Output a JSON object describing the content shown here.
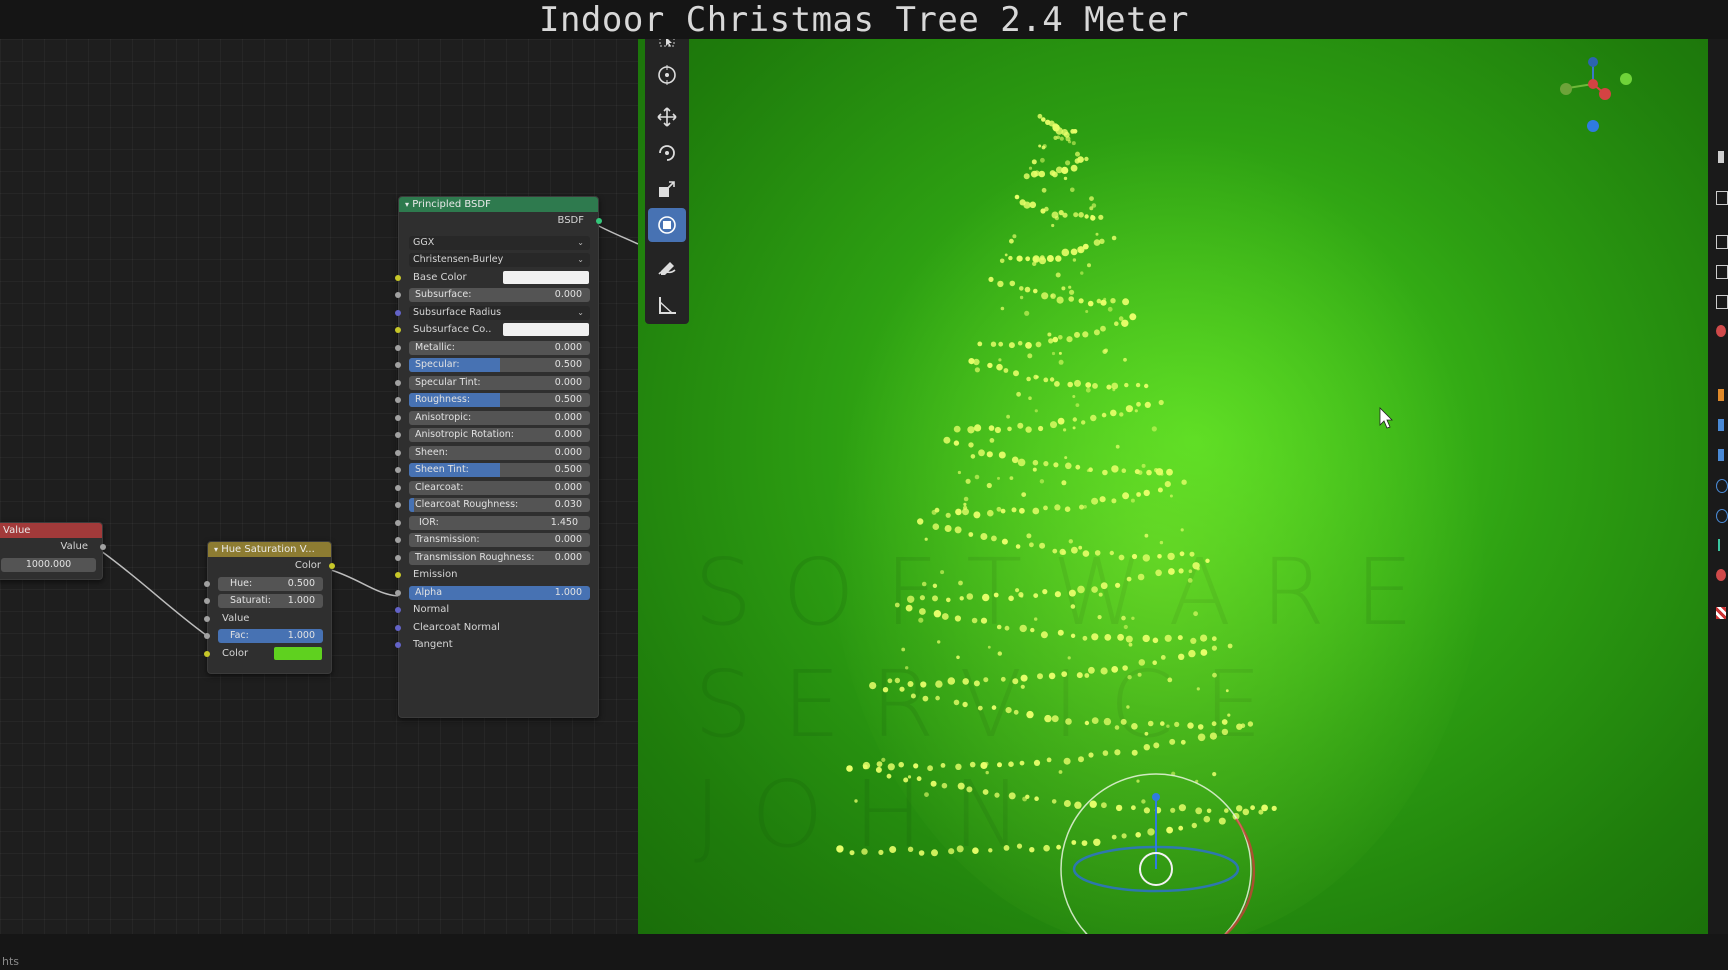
{
  "title": "Indoor Christmas Tree 2.4 Meter",
  "status_text": "hts",
  "colors": {
    "viewport_green": "#3fbf18",
    "active_blue": "#4772b3",
    "value_header": "#a23a3a",
    "hue_header": "#8d7c32",
    "bsdf_header": "#2e7a4e",
    "light_yellow": "#e8ff6a"
  },
  "value_node": {
    "title": "Value",
    "output": "Value",
    "value": "1000.000"
  },
  "hue_node": {
    "title": "Hue Saturation V...",
    "output": "Color",
    "hue_label": "Hue:",
    "hue_value": "0.500",
    "sat_label": "Saturati:",
    "sat_value": "1.000",
    "value_label": "Value",
    "fac_label": "Fac:",
    "fac_value": "1.000",
    "color_label": "Color",
    "color_swatch": "#5fd11f"
  },
  "bsdf_node": {
    "title": "Principled BSDF",
    "output": "BSDF",
    "distribution": "GGX",
    "subsurface_method": "Christensen-Burley",
    "base_color_label": "Base Color",
    "subsurface_label": "Subsurface:",
    "subsurface_value": "0.000",
    "subsurface_radius_label": "Subsurface Radius",
    "subsurface_color_label": "Subsurface Co..",
    "metallic_label": "Metallic:",
    "metallic_value": "0.000",
    "specular_label": "Specular:",
    "specular_value": "0.500",
    "specular_tint_label": "Specular Tint:",
    "specular_tint_value": "0.000",
    "roughness_label": "Roughness:",
    "roughness_value": "0.500",
    "anisotropic_label": "Anisotropic:",
    "anisotropic_value": "0.000",
    "anisotropic_rotation_label": "Anisotropic Rotation:",
    "anisotropic_rotation_value": "0.000",
    "sheen_label": "Sheen:",
    "sheen_value": "0.000",
    "sheen_tint_label": "Sheen Tint:",
    "sheen_tint_value": "0.500",
    "clearcoat_label": "Clearcoat:",
    "clearcoat_value": "0.000",
    "clearcoat_roughness_label": "Clearcoat Roughness:",
    "clearcoat_roughness_value": "0.030",
    "ior_label": "IOR:",
    "ior_value": "1.450",
    "transmission_label": "Transmission:",
    "transmission_value": "0.000",
    "transmission_roughness_label": "Transmission Roughness:",
    "transmission_roughness_value": "0.000",
    "emission_label": "Emission",
    "alpha_label": "Alpha",
    "alpha_value": "1.000",
    "normal_label": "Normal",
    "clearcoat_normal_label": "Clearcoat Normal",
    "tangent_label": "Tangent"
  },
  "watermark": [
    "SOFTWARE",
    "SERVICE",
    "JOHN"
  ],
  "tools": [
    "select-box-icon",
    "cursor-icon",
    "move-icon",
    "rotate-icon",
    "scale-icon",
    "transform-icon",
    "annotate-icon",
    "measure-icon"
  ]
}
